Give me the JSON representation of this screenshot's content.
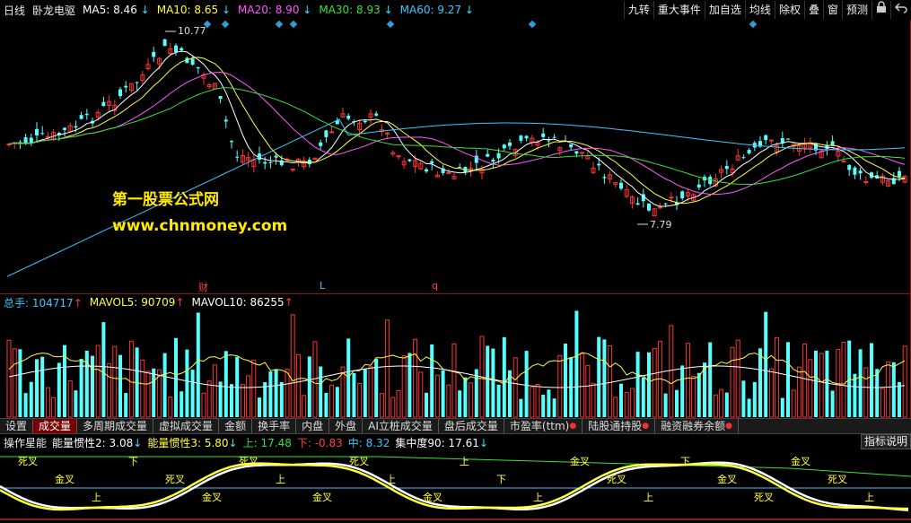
{
  "header": {
    "period": "日线",
    "stock_name": "卧龙电驱",
    "ma": [
      {
        "label": "MA5:",
        "value": "8.46",
        "dir": "↓",
        "color": "#ffffff"
      },
      {
        "label": "MA10:",
        "value": "8.65",
        "dir": "↓",
        "color": "#ffff3c"
      },
      {
        "label": "MA20:",
        "value": "8.90",
        "dir": "↓",
        "color": "#ff5aff"
      },
      {
        "label": "MA30:",
        "value": "8.93",
        "dir": "↓",
        "color": "#38e038"
      },
      {
        "label": "MA60:",
        "value": "9.27",
        "dir": "↓",
        "color": "#38c8ff"
      }
    ],
    "buttons": [
      "九转",
      "重大事件",
      "加自选",
      "均线",
      "除权",
      "叠",
      "窗",
      "预测"
    ],
    "lock_icon": "lock-icon",
    "back_icon": "back-icon"
  },
  "main_chart": {
    "watermark_title": "第一股票公式网",
    "watermark_url": "www.chnmoney.com",
    "high_label": "10.77",
    "low_label": "7.79",
    "markers": [
      {
        "text": "财",
        "color": "#ff4040"
      },
      {
        "text": "L",
        "color": "#3ac8ff"
      },
      {
        "text": "q",
        "color": "#ff4040"
      }
    ]
  },
  "volume_panel": {
    "items": [
      {
        "label": "总手:",
        "value": "104717",
        "dir": "↑",
        "color": "#38c8ff"
      },
      {
        "label": "MAVOL5:",
        "value": "90709",
        "dir": "↑",
        "color": "#ffff3c"
      },
      {
        "label": "MAVOL10:",
        "value": "86255",
        "dir": "↑",
        "color": "#ffffff"
      }
    ]
  },
  "tabs": [
    {
      "label": "设置",
      "active": false,
      "dot": false
    },
    {
      "label": "成交量",
      "active": true,
      "dot": false
    },
    {
      "label": "多周期成交量",
      "active": false,
      "dot": false
    },
    {
      "label": "虚拟成交量",
      "active": false,
      "dot": false
    },
    {
      "label": "金额",
      "active": false,
      "dot": false
    },
    {
      "label": "换手率",
      "active": false,
      "dot": false
    },
    {
      "label": "内盘",
      "active": false,
      "dot": false
    },
    {
      "label": "外盘",
      "active": false,
      "dot": false
    },
    {
      "label": "AI立桩成交量",
      "active": false,
      "dot": false
    },
    {
      "label": "盘后成交量",
      "active": false,
      "dot": false
    },
    {
      "label": "市盈率(ttm)",
      "active": false,
      "dot": true
    },
    {
      "label": "陆股通持股",
      "active": false,
      "dot": true
    },
    {
      "label": "融资融券余额",
      "active": false,
      "dot": true
    }
  ],
  "indicator_panel": {
    "name": "操作星能",
    "items": [
      {
        "label": "能量惯性2:",
        "value": "3.08",
        "dir": "↓",
        "color": "#ffffff"
      },
      {
        "label": "能量惯性3:",
        "value": "5.80",
        "dir": "↓",
        "color": "#ffff3c"
      },
      {
        "label": "上:",
        "value": "17.48",
        "dir": "",
        "color": "#38e038"
      },
      {
        "label": "下:",
        "value": "-0.83",
        "dir": "",
        "color": "#ff4040"
      },
      {
        "label": "中:",
        "value": "8.32",
        "dir": "",
        "color": "#38c8ff"
      },
      {
        "label": "集中度90:",
        "value": "17.61",
        "dir": "↓",
        "color": "#ffffff"
      }
    ],
    "help_button": "指标说明",
    "signals": [
      "死叉",
      "金叉",
      "上",
      "下",
      "死叉",
      "金叉",
      "死叉",
      "上",
      "金叉",
      "死叉",
      "上",
      "金叉",
      "上",
      "下",
      "上",
      "金叉",
      "死叉",
      "上",
      "下",
      "金叉",
      "死叉",
      "金叉",
      "死叉",
      "上"
    ]
  }
}
